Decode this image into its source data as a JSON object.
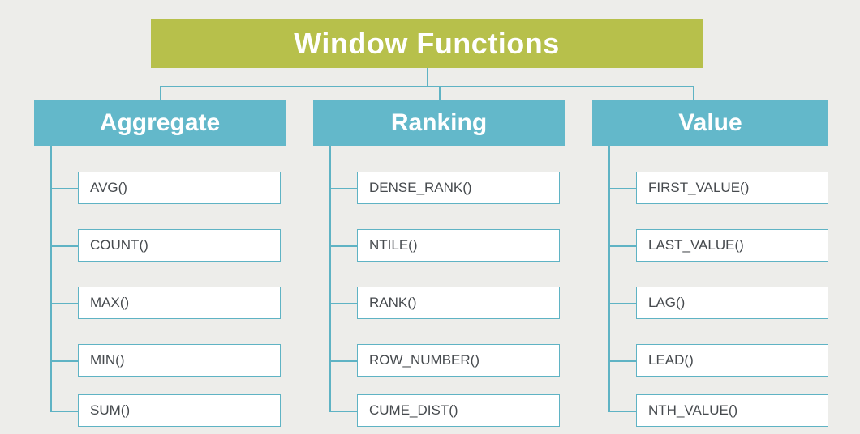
{
  "colors": {
    "root_bg": "#b7c04b",
    "cat_bg": "#63b8ca",
    "line": "#5fb3c4",
    "leaf_text": "#464a4e",
    "page_bg": "#ededea"
  },
  "title": "Window Functions",
  "categories": [
    {
      "name": "Aggregate",
      "items": [
        "AVG()",
        "COUNT()",
        "MAX()",
        "MIN()",
        "SUM()"
      ]
    },
    {
      "name": "Ranking",
      "items": [
        "DENSE_RANK()",
        "NTILE()",
        "RANK()",
        "ROW_NUMBER()",
        "CUME_DIST()"
      ]
    },
    {
      "name": "Value",
      "items": [
        "FIRST_VALUE()",
        "LAST_VALUE()",
        "LAG()",
        "LEAD()",
        "NTH_VALUE()"
      ]
    }
  ]
}
